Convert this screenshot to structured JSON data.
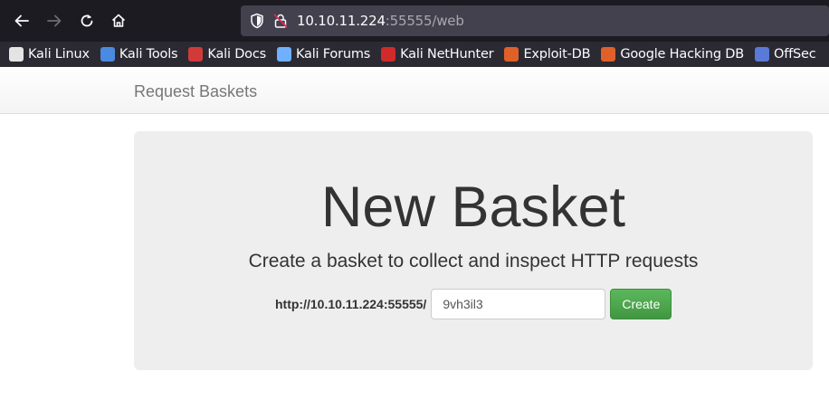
{
  "browser": {
    "url_host": "10.10.11.224",
    "url_rest": ":55555/web",
    "bookmarks": [
      {
        "label": "Kali Linux",
        "color": "#e4e4e4"
      },
      {
        "label": "Kali Tools",
        "color": "#4a8ae0"
      },
      {
        "label": "Kali Docs",
        "color": "#d23a3a"
      },
      {
        "label": "Kali Forums",
        "color": "#6fb0ff"
      },
      {
        "label": "Kali NetHunter",
        "color": "#d02a2a"
      },
      {
        "label": "Exploit-DB",
        "color": "#e0602a"
      },
      {
        "label": "Google Hacking DB",
        "color": "#e0602a"
      },
      {
        "label": "OffSec",
        "color": "#5a7ad8"
      }
    ]
  },
  "navbar": {
    "brand": "Request Baskets"
  },
  "main": {
    "title": "New Basket",
    "lead": "Create a basket to collect and inspect HTTP requests",
    "base_url": "http://10.10.11.224:55555/",
    "basket_name": "9vh3il3",
    "create_label": "Create"
  },
  "colors": {
    "create_button": "#449d44",
    "jumbotron_bg": "#eeeeee"
  }
}
